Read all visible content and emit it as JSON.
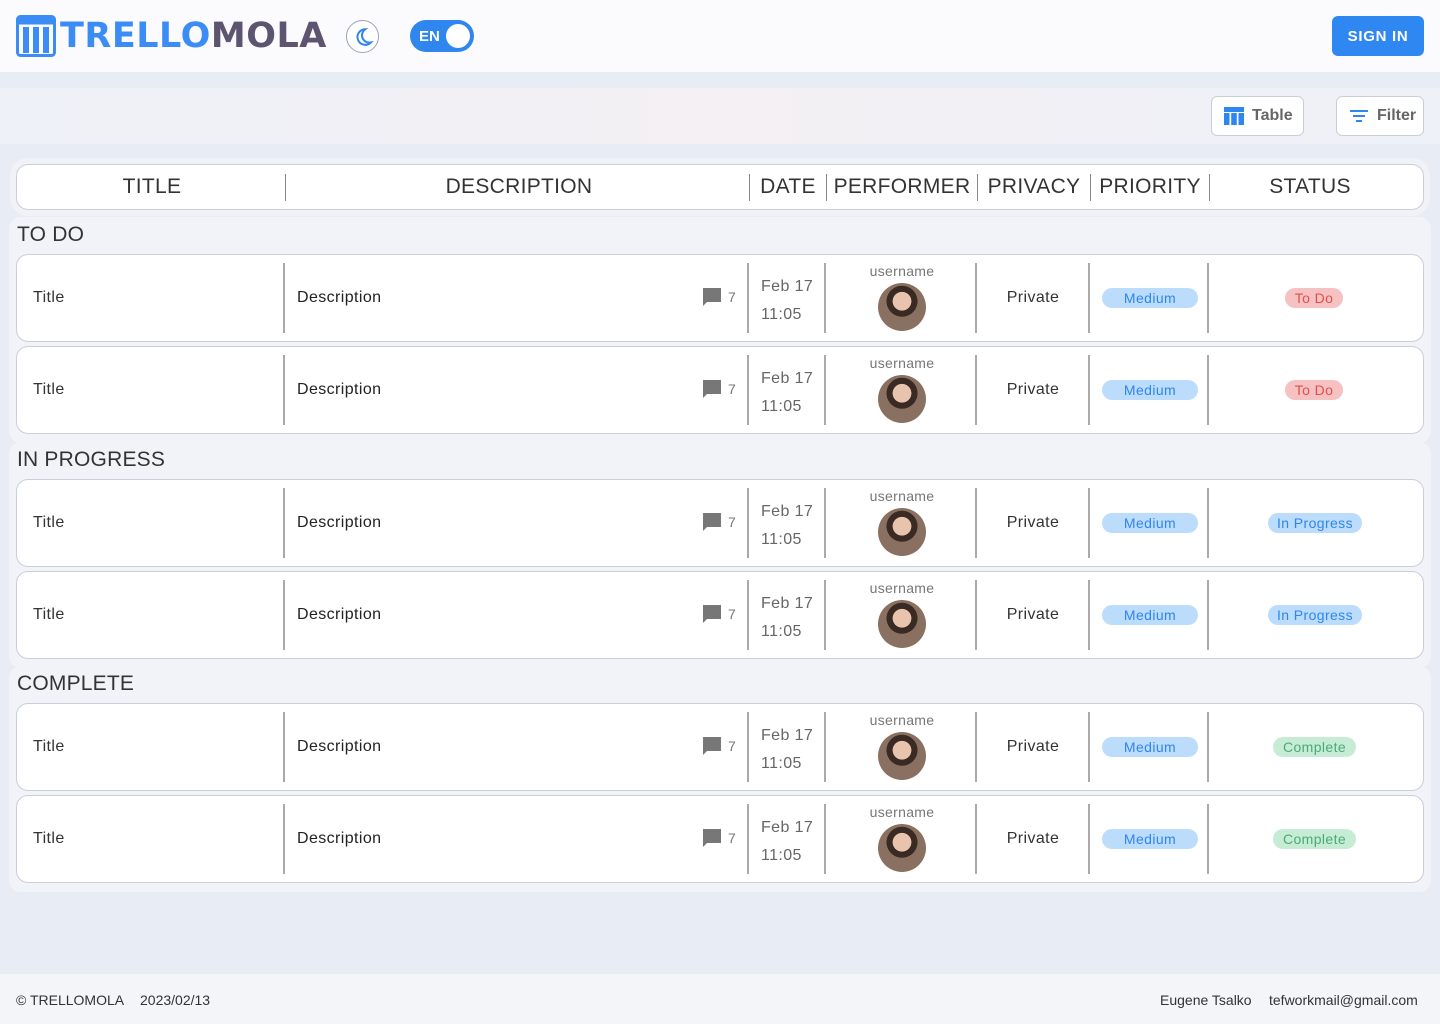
{
  "header": {
    "logo_part1": "TRELLO",
    "logo_part2": "MOLA",
    "lang": "EN",
    "signin_label": "SIGN IN"
  },
  "toolbar": {
    "table_label": "Table",
    "filter_label": "Filter"
  },
  "columns": [
    "TITLE",
    "DESCRIPTION",
    "DATE",
    "PERFORMER",
    "PRIVACY",
    "PRIORITY",
    "STATUS"
  ],
  "groups": [
    {
      "name": "TO DO",
      "rows": [
        {
          "title": "Title",
          "description": "Description",
          "comments": "7",
          "date": "Feb 17",
          "time": "11:05",
          "username": "username",
          "privacy": "Private",
          "priority": "Medium",
          "status": "To Do"
        },
        {
          "title": "Title",
          "description": "Description",
          "comments": "7",
          "date": "Feb 17",
          "time": "11:05",
          "username": "username",
          "privacy": "Private",
          "priority": "Medium",
          "status": "To Do"
        }
      ]
    },
    {
      "name": "IN PROGRESS",
      "rows": [
        {
          "title": "Title",
          "description": "Description",
          "comments": "7",
          "date": "Feb 17",
          "time": "11:05",
          "username": "username",
          "privacy": "Private",
          "priority": "Medium",
          "status": "In Progress"
        },
        {
          "title": "Title",
          "description": "Description",
          "comments": "7",
          "date": "Feb 17",
          "time": "11:05",
          "username": "username",
          "privacy": "Private",
          "priority": "Medium",
          "status": "In Progress"
        }
      ]
    },
    {
      "name": "COMPLETE",
      "rows": [
        {
          "title": "Title",
          "description": "Description",
          "comments": "7",
          "date": "Feb 17",
          "time": "11:05",
          "username": "username",
          "privacy": "Private",
          "priority": "Medium",
          "status": "Complete"
        },
        {
          "title": "Title",
          "description": "Description",
          "comments": "7",
          "date": "Feb 17",
          "time": "11:05",
          "username": "username",
          "privacy": "Private",
          "priority": "Medium",
          "status": "Complete"
        }
      ]
    }
  ],
  "footer": {
    "copyright": "© TRELLOMOLA",
    "date": "2023/02/13",
    "author": "Eugene Tsalko",
    "email": "tefworkmail@gmail.com"
  },
  "colors": {
    "accent": "#2f86ee",
    "todo": "#f6c1c1",
    "in_progress": "#bcdcfb",
    "complete": "#c7ecd6"
  }
}
